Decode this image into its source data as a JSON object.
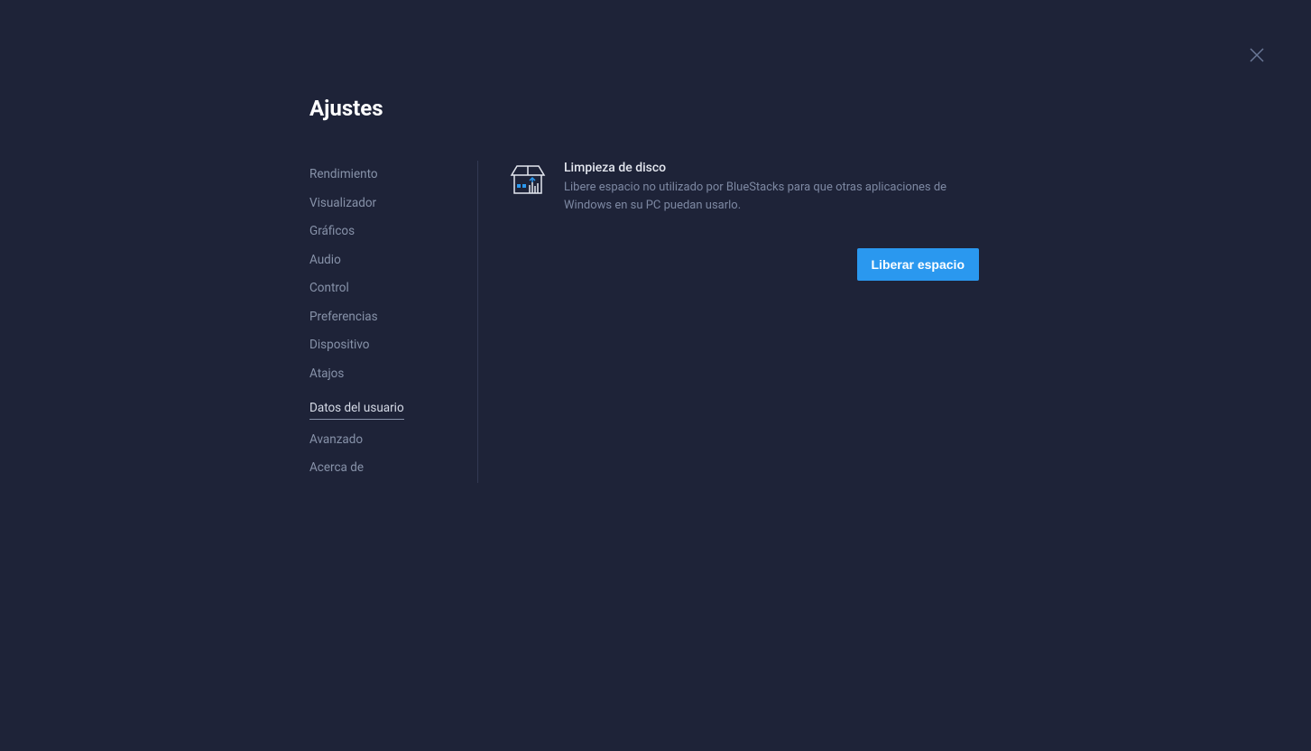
{
  "header": {
    "title": "Ajustes"
  },
  "sidebar": {
    "items": [
      {
        "label": "Rendimiento",
        "active": false
      },
      {
        "label": "Visualizador",
        "active": false
      },
      {
        "label": "Gráficos",
        "active": false
      },
      {
        "label": "Audio",
        "active": false
      },
      {
        "label": "Control",
        "active": false
      },
      {
        "label": "Preferencias",
        "active": false
      },
      {
        "label": "Dispositivo",
        "active": false
      },
      {
        "label": "Atajos",
        "active": false
      },
      {
        "label": "Datos del usuario",
        "active": true
      },
      {
        "label": "Avanzado",
        "active": false
      },
      {
        "label": "Acerca de",
        "active": false
      }
    ]
  },
  "main": {
    "disk_cleanup": {
      "title": "Limpieza de disco",
      "description": "Libere espacio no utilizado por BlueStacks para que otras aplicaciones de Windows en su PC puedan usarlo.",
      "button": "Liberar espacio"
    }
  }
}
